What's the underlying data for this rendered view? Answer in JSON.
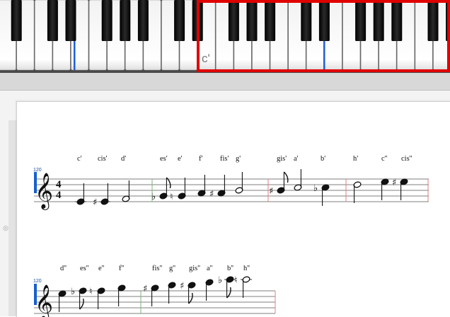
{
  "keyboard": {
    "range_label": "c'",
    "selection_color": "#e00000",
    "octave_marker_color": "#1f5fd6"
  },
  "score": {
    "tempo_1": "120",
    "tempo_2": "120",
    "time_signature": {
      "numerator": "4",
      "denominator": "4"
    },
    "system1_lyrics": [
      "c'",
      "cis'",
      "d'",
      "es'",
      "e'",
      "f'",
      "fis'",
      "g'",
      "gis'",
      "a'",
      "b'",
      "h'",
      "c''",
      "cis''"
    ],
    "system2_lyrics": [
      "d''",
      "es''",
      "e''",
      "f''",
      "fis''",
      "g''",
      "gis''",
      "a''",
      "b''",
      "h''"
    ]
  },
  "sidebar": {
    "handle_symbol": "◎"
  }
}
